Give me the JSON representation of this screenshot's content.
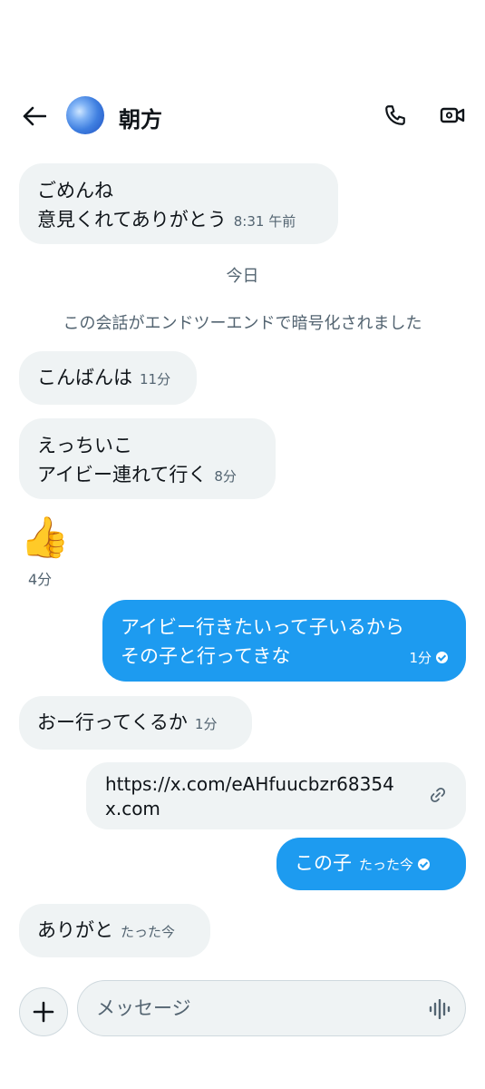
{
  "header": {
    "title": "朝方",
    "back_icon": "arrow-left-icon",
    "call_icon": "phone-icon",
    "video_icon": "video-camera-icon"
  },
  "messages": [
    {
      "dir": "in",
      "lines": [
        "ごめんね",
        "意見くれてありがとう"
      ],
      "time": "8:31 午前"
    },
    {
      "dir": "in",
      "lines": [
        "こんばんは"
      ],
      "time": "11分"
    },
    {
      "dir": "in",
      "lines": [
        "えっちいこ",
        "アイビー連れて行く"
      ],
      "time": "8分"
    },
    {
      "dir": "in",
      "emoji": "👍",
      "time": "4分"
    },
    {
      "dir": "out",
      "lines": [
        "アイビー行きたいって子いるから",
        "その子と行ってきな"
      ],
      "time": "1分"
    },
    {
      "dir": "in",
      "lines": [
        "おー行ってくるか"
      ],
      "time": "1分"
    },
    {
      "dir": "out",
      "link": {
        "url": "https://x.com/eAHfuucbzr68354",
        "domain": "x.com"
      }
    },
    {
      "dir": "out",
      "lines": [
        "この子"
      ],
      "time": "たった今"
    },
    {
      "dir": "in",
      "lines": [
        "ありがと"
      ],
      "time": "たった今"
    }
  ],
  "day_separator": "今日",
  "encryption_notice": "この会話がエンドツーエンドで暗号化されました",
  "composer": {
    "placeholder": "メッセージ",
    "plus_icon": "plus-icon",
    "voice_icon": "voice-waveform-icon"
  },
  "colors": {
    "accent": "#1d9bf0",
    "incoming_bubble": "#eff3f4",
    "secondary_text": "#536471"
  }
}
